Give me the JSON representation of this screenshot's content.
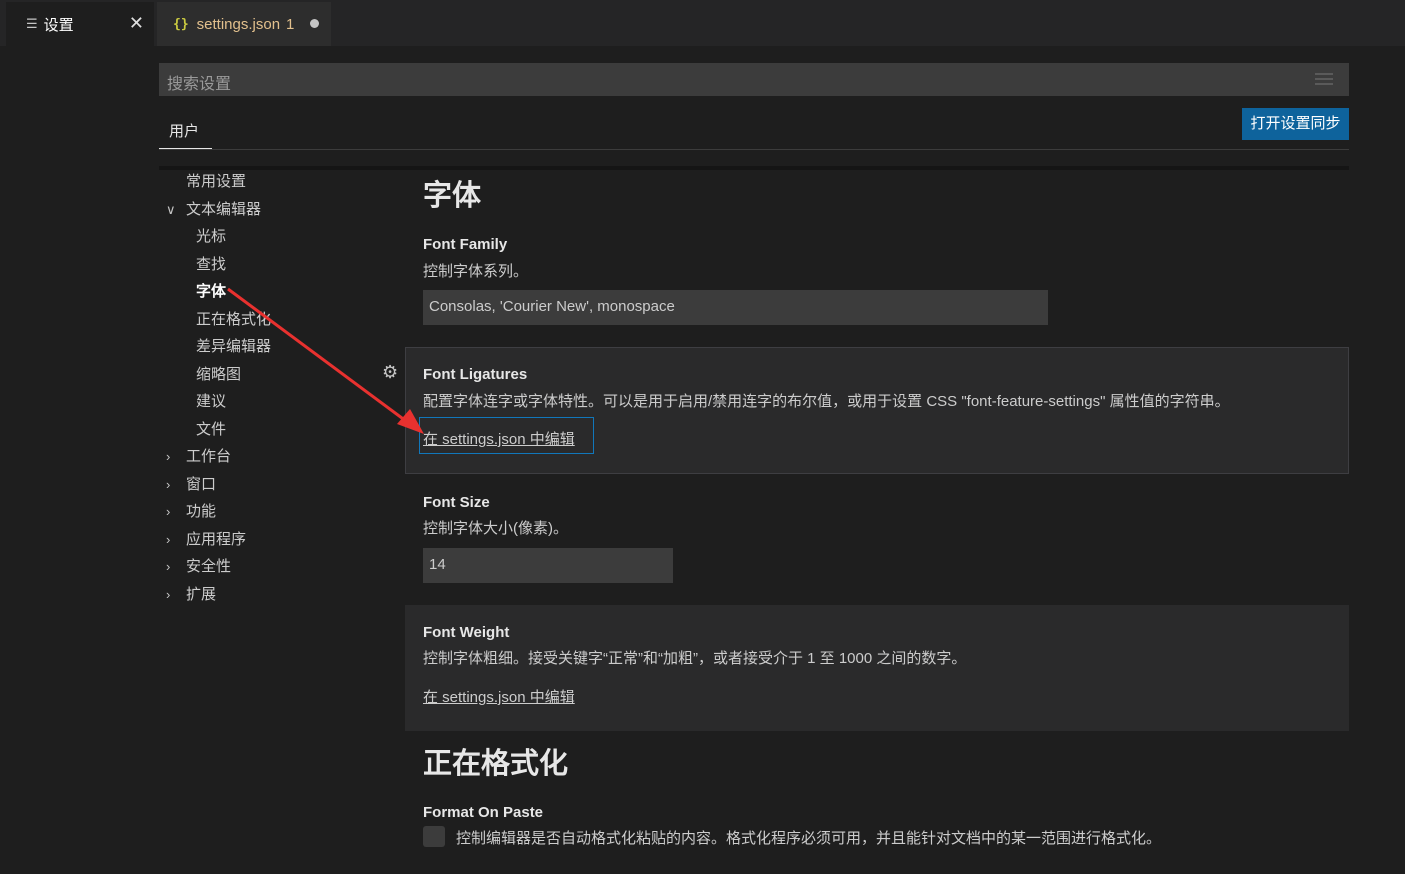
{
  "tabs": {
    "settings": {
      "label": "设置",
      "close": "✕"
    },
    "json": {
      "label": "settings.json",
      "badge": "1",
      "braces": "{}"
    }
  },
  "search": {
    "placeholder": "搜索设置"
  },
  "header": {
    "user_tab": "用户",
    "sync_button": "打开设置同步"
  },
  "toc": {
    "items": [
      {
        "label": "常用设置"
      },
      {
        "label": "文本编辑器",
        "chevron": "∨"
      },
      {
        "label": "光标"
      },
      {
        "label": "查找"
      },
      {
        "label": "字体"
      },
      {
        "label": "正在格式化"
      },
      {
        "label": "差异编辑器"
      },
      {
        "label": "缩略图"
      },
      {
        "label": "建议"
      },
      {
        "label": "文件"
      },
      {
        "label": "工作台",
        "chevron": "›"
      },
      {
        "label": "窗口",
        "chevron": "›"
      },
      {
        "label": "功能",
        "chevron": "›"
      },
      {
        "label": "应用程序",
        "chevron": "›"
      },
      {
        "label": "安全性",
        "chevron": "›"
      },
      {
        "label": "扩展",
        "chevron": "›"
      }
    ]
  },
  "content": {
    "font_section": "字体",
    "font_family": {
      "title": "Font Family",
      "desc": "控制字体系列。",
      "value": "Consolas, 'Courier New', monospace"
    },
    "font_ligatures": {
      "title": "Font Ligatures",
      "desc": "配置字体连字或字体特性。可以是用于启用/禁用连字的布尔值，或用于设置 CSS \"font-feature-settings\" 属性值的字符串。",
      "link": "在 settings.json 中编辑"
    },
    "font_size": {
      "title": "Font Size",
      "desc": "控制字体大小(像素)。",
      "value": "14"
    },
    "font_weight": {
      "title": "Font Weight",
      "desc": "控制字体粗细。接受关键字“正常”和“加粗”，或者接受介于 1 至 1000 之间的数字。",
      "link": "在 settings.json 中编辑"
    },
    "formatting_section": "正在格式化",
    "format_on_paste": {
      "title": "Format On Paste",
      "desc": "控制编辑器是否自动格式化粘贴的内容。格式化程序必须可用，并且能针对文档中的某一范围进行格式化。"
    }
  },
  "colors": {
    "accent": "#0e639c",
    "annotation_arrow": "#e8312f"
  }
}
